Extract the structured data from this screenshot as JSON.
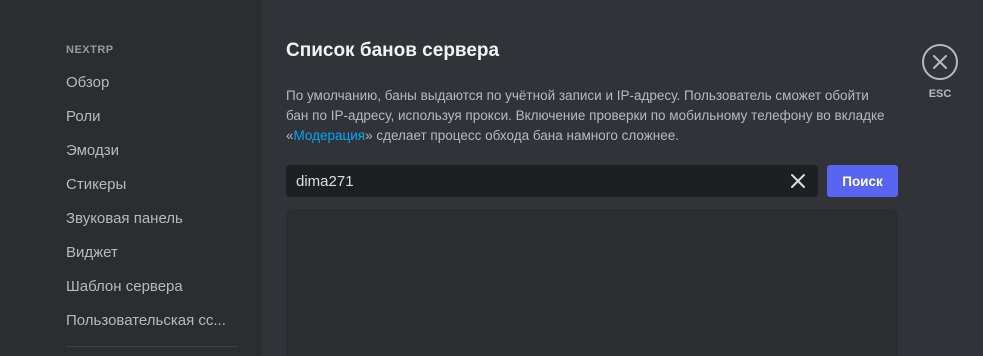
{
  "sidebar": {
    "header": "NEXTRP",
    "items": [
      {
        "label": "Обзор"
      },
      {
        "label": "Роли"
      },
      {
        "label": "Эмодзи"
      },
      {
        "label": "Стикеры"
      },
      {
        "label": "Звуковая панель"
      },
      {
        "label": "Виджет"
      },
      {
        "label": "Шаблон сервера"
      },
      {
        "label": "Пользовательская сс..."
      }
    ]
  },
  "main": {
    "title": "Список банов сервера",
    "description": {
      "part1": "По умолчанию, баны выдаются по учётной записи и IP-адресу. Пользователь сможет обойти бан по IP-адресу, используя прокси. Включение проверки по мобильному телефону во вкладке «",
      "link": "Модерация",
      "part2": "» сделает процесс обхода бана намного сложнее."
    },
    "search": {
      "value": "dima271",
      "button_label": "Поиск"
    }
  },
  "close": {
    "label": "ESC"
  },
  "colors": {
    "accent": "#5865f2",
    "link": "#00a8fc",
    "background": "#313338",
    "sidebar": "#2b2d31"
  }
}
